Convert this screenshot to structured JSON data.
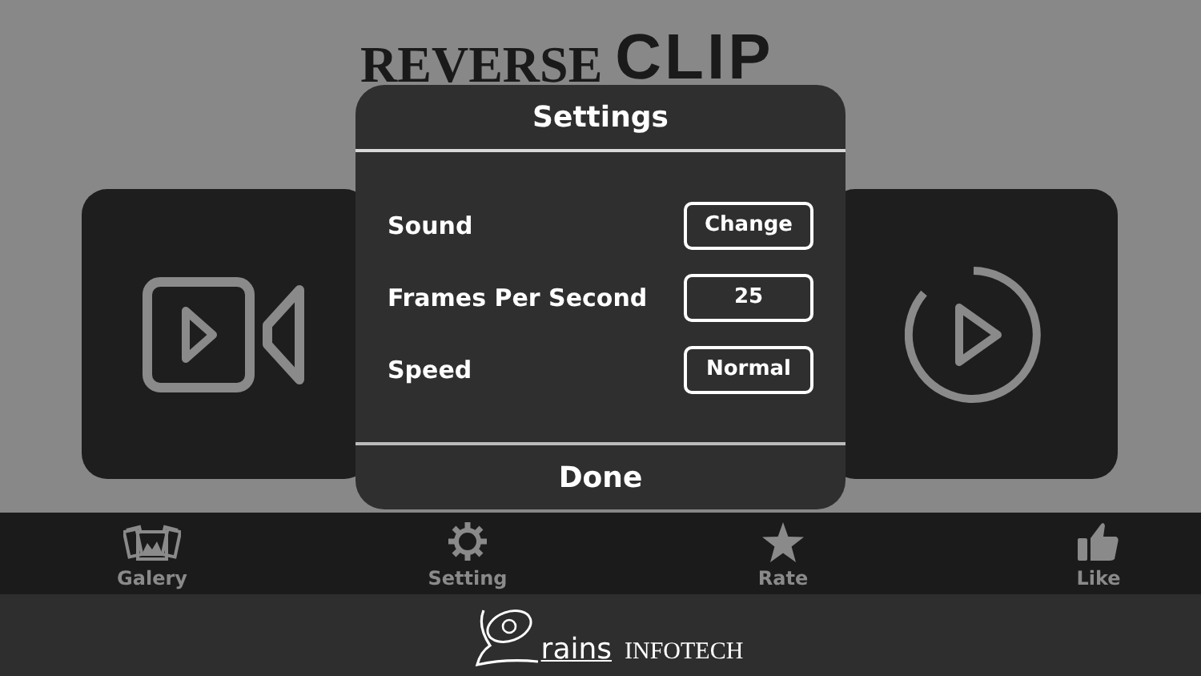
{
  "app_title": {
    "line_1": "REVERSE",
    "line_2": "CLIP"
  },
  "cards": [
    {
      "kind": "camera"
    },
    {
      "kind": "play"
    }
  ],
  "dialog": {
    "title": "Settings",
    "rows": [
      {
        "label": "Sound",
        "value": "Change"
      },
      {
        "label": "Frames Per Second",
        "value": "25"
      },
      {
        "label": "Speed",
        "value": "Normal"
      }
    ],
    "done": "Done"
  },
  "nav": [
    {
      "kind": "gallery",
      "label": "Galery"
    },
    {
      "kind": "gear",
      "label": "Setting"
    },
    {
      "kind": "star",
      "label": "Rate"
    },
    {
      "kind": "thumb",
      "label": "Like"
    }
  ],
  "footer": {
    "brand": "rains",
    "company": "INFOTECH"
  }
}
